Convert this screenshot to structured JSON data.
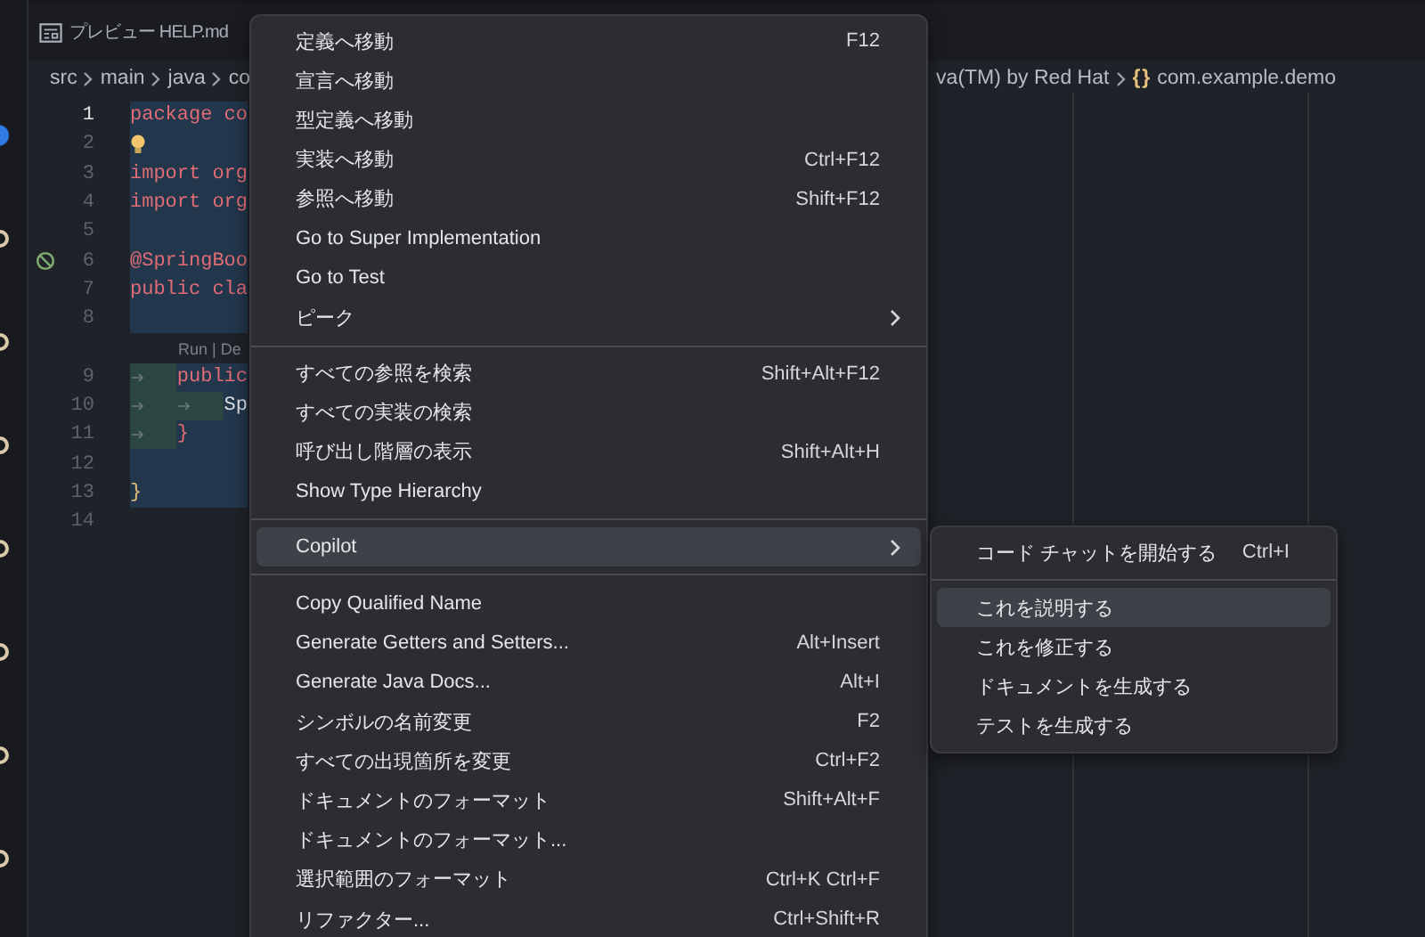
{
  "tab": {
    "label": "プレビュー HELP.md"
  },
  "breadcrumb": {
    "leading": [
      "src",
      "main",
      "java",
      "co"
    ],
    "trailing": [
      "va(TM) by Red Hat"
    ],
    "namespace_icon": "{}",
    "namespace": "com.example.demo"
  },
  "code_lines": [
    {
      "kind": "code",
      "number": "1",
      "text": "package co",
      "color": "#e06c75",
      "active": true,
      "lightbulb": false,
      "blocked": false
    },
    {
      "kind": "code",
      "number": "2",
      "active": false,
      "lightbulb": true,
      "blocked": false
    },
    {
      "kind": "code",
      "number": "3",
      "text": "import org",
      "color": "#e06c75",
      "active": false,
      "lightbulb": false,
      "blocked": false
    },
    {
      "kind": "code",
      "number": "4",
      "text": "import org",
      "color": "#e06c75",
      "active": false,
      "lightbulb": false,
      "blocked": false
    },
    {
      "kind": "code",
      "number": "5",
      "active": false,
      "lightbulb": false,
      "blocked": false
    },
    {
      "kind": "code",
      "number": "6",
      "text": "@SpringBoo",
      "color": "#e06c75",
      "active": false,
      "lightbulb": false,
      "blocked": true
    },
    {
      "kind": "code",
      "number": "7",
      "text": "public cla",
      "color": "#e06c75",
      "active": false,
      "lightbulb": false,
      "blocked": false
    },
    {
      "kind": "code",
      "number": "8",
      "active": false,
      "lightbulb": false,
      "blocked": false
    },
    {
      "kind": "lens",
      "text": "Run | De"
    },
    {
      "kind": "code",
      "number": "9",
      "text": "\tpublic",
      "color": "#e06c75",
      "active": false,
      "lightbulb": false,
      "blocked": false
    },
    {
      "kind": "code",
      "number": "10",
      "text": "\t\tSp",
      "color": "#dcdfe4",
      "active": false,
      "lightbulb": false,
      "blocked": false
    },
    {
      "kind": "code",
      "number": "11",
      "text": "\t}",
      "color": "#e06c75",
      "active": false,
      "lightbulb": false,
      "blocked": false
    },
    {
      "kind": "code",
      "number": "12",
      "active": false,
      "lightbulb": false,
      "blocked": false
    },
    {
      "kind": "code",
      "number": "13",
      "text": "}",
      "color": "#e5c07b",
      "active": false,
      "lightbulb": false,
      "blocked": false
    },
    {
      "kind": "code",
      "number": "14",
      "active": false,
      "lightbulb": false,
      "blocked": false
    }
  ],
  "context_menu": {
    "groups": [
      [
        {
          "label": "定義へ移動",
          "shortcut": "F12",
          "submenu": false,
          "selected": false
        },
        {
          "label": "宣言へ移動",
          "submenu": false,
          "selected": false
        },
        {
          "label": "型定義へ移動",
          "submenu": false,
          "selected": false
        },
        {
          "label": "実装へ移動",
          "shortcut": "Ctrl+F12",
          "submenu": false,
          "selected": false
        },
        {
          "label": "参照へ移動",
          "shortcut": "Shift+F12",
          "submenu": false,
          "selected": false
        },
        {
          "label": "Go to Super Implementation",
          "submenu": false,
          "selected": false
        },
        {
          "label": "Go to Test",
          "submenu": false,
          "selected": false
        },
        {
          "label": "ピーク",
          "submenu": true,
          "selected": false
        }
      ],
      [
        {
          "label": "すべての参照を検索",
          "shortcut": "Shift+Alt+F12",
          "submenu": false,
          "selected": false
        },
        {
          "label": "すべての実装の検索",
          "submenu": false,
          "selected": false
        },
        {
          "label": "呼び出し階層の表示",
          "shortcut": "Shift+Alt+H",
          "submenu": false,
          "selected": false
        },
        {
          "label": "Show Type Hierarchy",
          "submenu": false,
          "selected": false
        }
      ],
      [
        {
          "label": "Copilot",
          "submenu": true,
          "selected": true
        }
      ],
      [
        {
          "label": "Copy Qualified Name",
          "submenu": false,
          "selected": false
        },
        {
          "label": "Generate Getters and Setters...",
          "shortcut": "Alt+Insert",
          "submenu": false,
          "selected": false
        },
        {
          "label": "Generate Java Docs...",
          "shortcut": "Alt+I",
          "submenu": false,
          "selected": false
        },
        {
          "label": "シンボルの名前変更",
          "shortcut": "F2",
          "submenu": false,
          "selected": false
        },
        {
          "label": "すべての出現箇所を変更",
          "shortcut": "Ctrl+F2",
          "submenu": false,
          "selected": false
        },
        {
          "label": "ドキュメントのフォーマット",
          "shortcut": "Shift+Alt+F",
          "submenu": false,
          "selected": false
        },
        {
          "label": "ドキュメントのフォーマット...",
          "submenu": false,
          "selected": false
        },
        {
          "label": "選択範囲のフォーマット",
          "shortcut": "Ctrl+K Ctrl+F",
          "submenu": false,
          "selected": false
        },
        {
          "label": "リファクター...",
          "shortcut": "Ctrl+Shift+R",
          "submenu": false,
          "selected": false
        }
      ]
    ]
  },
  "submenu": {
    "groups": [
      [
        {
          "label": "コード チャットを開始する",
          "shortcut": "Ctrl+I",
          "selected": false
        }
      ],
      [
        {
          "label": "これを説明する",
          "selected": true
        },
        {
          "label": "これを修正する",
          "selected": false
        },
        {
          "label": "ドキュメントを生成する",
          "selected": false
        },
        {
          "label": "テストを生成する",
          "selected": false
        }
      ]
    ]
  }
}
